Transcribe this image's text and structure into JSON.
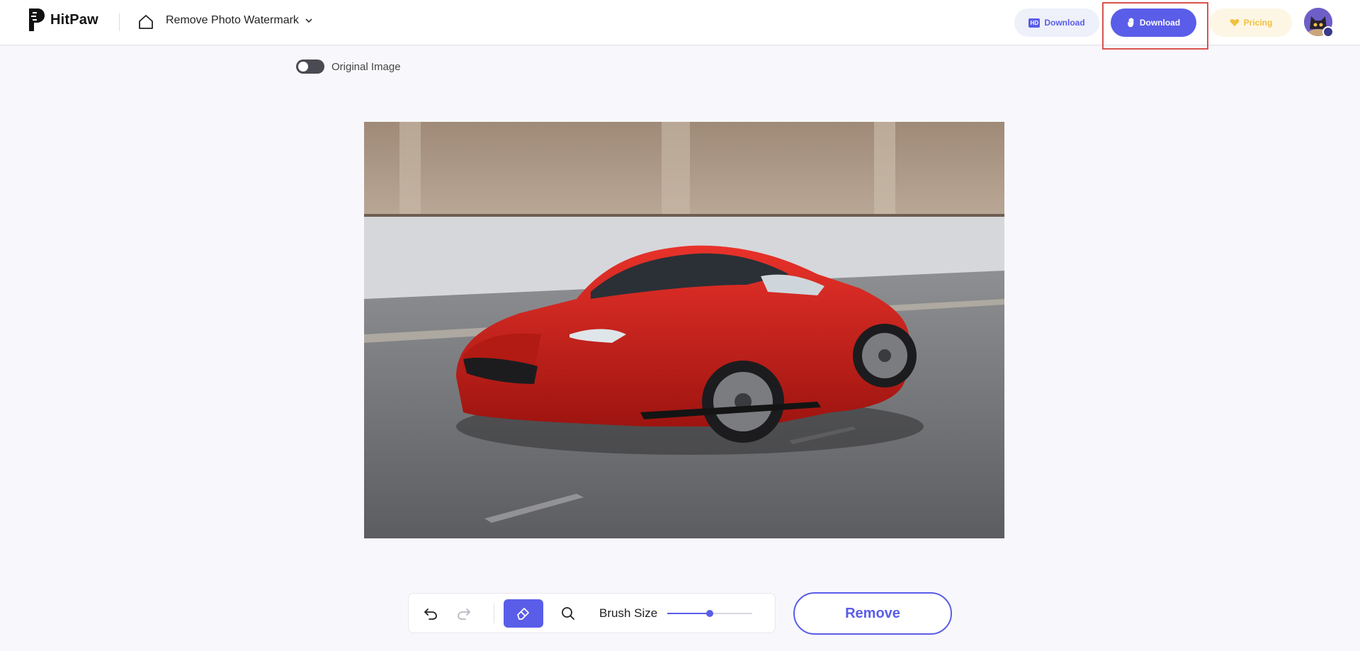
{
  "header": {
    "brand": "HitPaw",
    "tool_name": "Remove Photo Watermark",
    "hd_download_label": "Download",
    "hd_badge": "HD",
    "download_label": "Download",
    "pricing_label": "Pricing"
  },
  "canvas": {
    "original_toggle_label": "Original Image",
    "original_toggle_on": false
  },
  "toolbar": {
    "brush_size_label": "Brush Size",
    "brush_size_value": 0.5,
    "remove_label": "Remove"
  },
  "colors": {
    "accent": "#5a5de8",
    "pricing": "#f1c040",
    "highlight": "#d9534f"
  },
  "icons": [
    "home-icon",
    "chevron-down-icon",
    "hd-icon",
    "hand-icon",
    "heart-icon",
    "undo-icon",
    "redo-icon",
    "eraser-icon",
    "magnifier-icon"
  ]
}
